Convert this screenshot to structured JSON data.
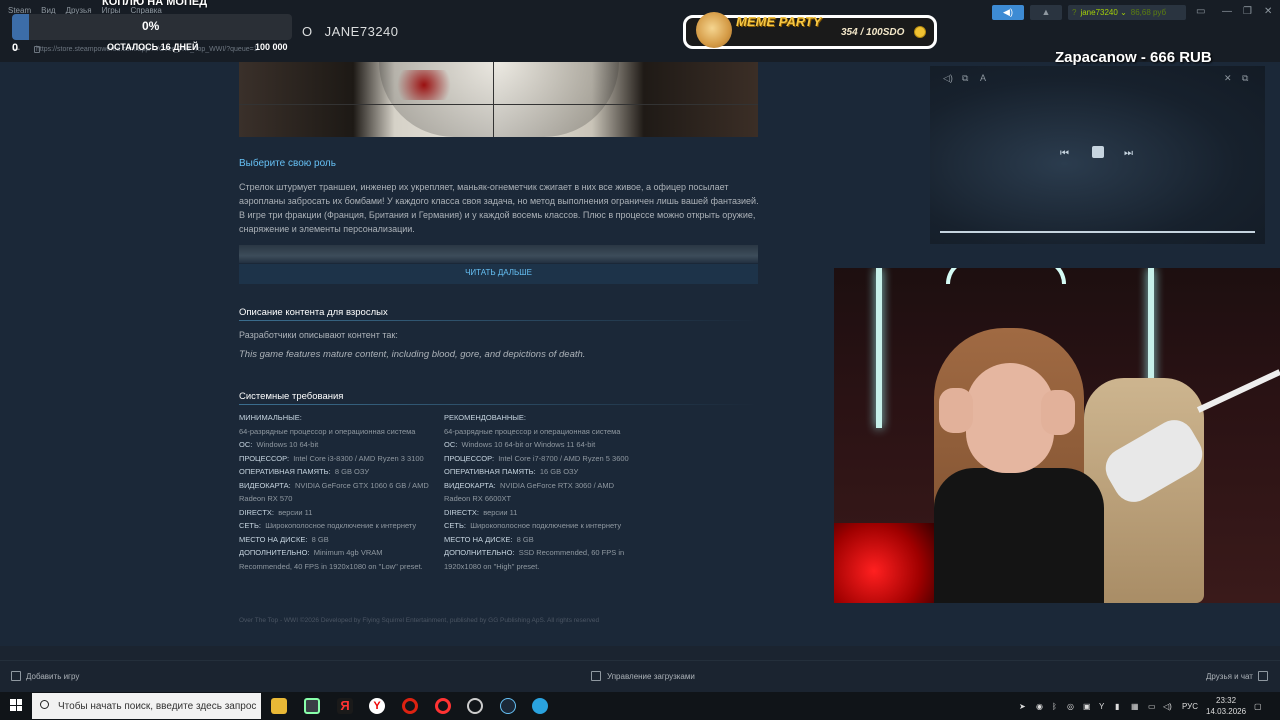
{
  "browser": {
    "menu": [
      "Steam",
      "Вид",
      "Друзья",
      "Игры",
      "Справка"
    ],
    "url": "https://store.steampowered.com/app/.../Over_The_Top_WWI/?queue=1",
    "username_tab": "JANE73240",
    "tab_prefix": "О"
  },
  "goal": {
    "title": "КОПЛЮ НА МОПЕД",
    "percent_label": "0%",
    "progress": 0.0,
    "left_label": "ОСТАЛОСЬ 16 ДНЕЙ",
    "target": "100 000",
    "current_overlay": "0"
  },
  "meme_party": {
    "title": "MEME PARTY",
    "count": "354 / 100SDO"
  },
  "steam_header": {
    "account_name": "jane73240",
    "balance": "86,68 руб",
    "question_mark": "?"
  },
  "donation": {
    "text": "Zapacanow - 666 RUB"
  },
  "content": {
    "role_link": "Выберите свою роль",
    "description": "Стрелок штурмует траншеи, инженер их укрепляет, маньяк-огнеметчик сжигает в них все живое, а офицер посылает аэропланы забросать их бомбами! У каждого класса своя задача, но метод выполнения ограничен лишь вашей фантазией. В игре три фракции (Франция, Британия и Германия) и у каждой восемь классов. Плюс в процессе можно открыть оружие, снаряжение и элементы персонализации.",
    "read_more": "ЧИТАТЬ ДАЛЬШЕ",
    "adult_heading": "Описание контента для взрослых",
    "adult_lead": "Разработчики описывают контент так:",
    "adult_quote": "This game features mature content, including blood, gore, and depictions of death.",
    "sysreq_heading": "Системные требования",
    "legal": "Over The Top - WWI ©2026 Developed by Flying Squirrel Entertainment, published by GG Publishing ApS. All rights reserved"
  },
  "sysreq": {
    "minimum": {
      "header": "МИНИМАЛЬНЫЕ:",
      "bits": "64-разрядные процессор и операционная система",
      "os_label": "ОС:",
      "os": "Windows 10 64-bit",
      "cpu_label": "ПРОЦЕССОР:",
      "cpu": "Intel Core i3-8300 / AMD Ryzen 3 3100",
      "ram_label": "ОПЕРАТИВНАЯ ПАМЯТЬ:",
      "ram": "8 GB ОЗУ",
      "gpu_label": "ВИДЕОКАРТА:",
      "gpu": "NVIDIA GeForce GTX 1060 6 GB / AMD Radeon RX 570",
      "dx_label": "DIRECTX:",
      "dx": "версии 11",
      "net_label": "СЕТЬ:",
      "net": "Широкополосное подключение к интернету",
      "disk_label": "МЕСТО НА ДИСКЕ:",
      "disk": "8 GB",
      "extra_label": "ДОПОЛНИТЕЛЬНО:",
      "extra": "Minimum 4gb VRAM Recommended, 40 FPS in 1920x1080 on \"Low\" preset."
    },
    "recommended": {
      "header": "РЕКОМЕНДОВАННЫЕ:",
      "bits": "64-разрядные процессор и операционная система",
      "os_label": "ОС:",
      "os": "Windows 10 64-bit or Windows 11 64-bit",
      "cpu_label": "ПРОЦЕССОР:",
      "cpu": "Intel Core i7-8700 / AMD Ryzen 5 3600",
      "ram_label": "ОПЕРАТИВНАЯ ПАМЯТЬ:",
      "ram": "16 GB ОЗУ",
      "gpu_label": "ВИДЕОКАРТА:",
      "gpu": "NVIDIA GeForce RTX 3060 / AMD Radeon RX 6600XT",
      "dx_label": "DIRECTX:",
      "dx": "версии 11",
      "net_label": "СЕТЬ:",
      "net": "Широкополосное подключение к интернету",
      "disk_label": "МЕСТО НА ДИСКЕ:",
      "disk": "8 GB",
      "extra_label": "ДОПОЛНИТЕЛЬНО:",
      "extra": "SSD Recommended, 60 FPS in 1920x1080 on \"High\" preset."
    }
  },
  "bottom_bar": {
    "add_game": "Добавить игру",
    "downloads": "Управление загрузками",
    "friends": "Друзья и чат"
  },
  "taskbar": {
    "search_placeholder": "Чтобы начать поиск, введите здесь запрос",
    "lang": "РУС",
    "time": "23:32",
    "date": "14.03.2026"
  }
}
